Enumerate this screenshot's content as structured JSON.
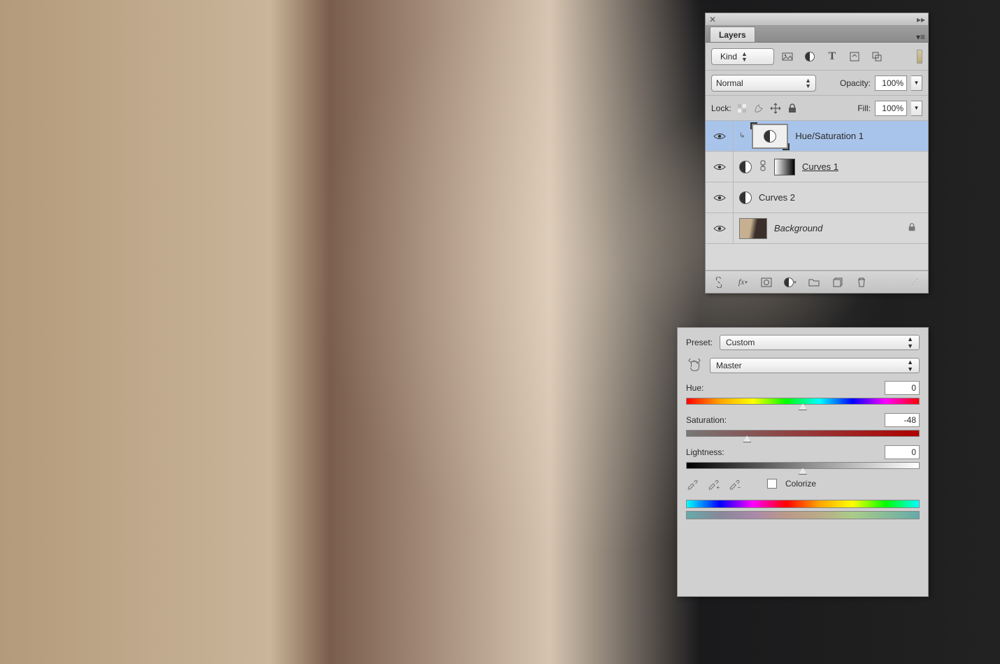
{
  "layers_panel": {
    "tab_label": "Layers",
    "filter": {
      "label": "Kind"
    },
    "blend_mode": "Normal",
    "opacity": {
      "label": "Opacity:",
      "value": "100%"
    },
    "lock_label": "Lock:",
    "fill": {
      "label": "Fill:",
      "value": "100%"
    },
    "layers": [
      {
        "name": "Hue/Saturation 1",
        "selected": true,
        "clipped": true
      },
      {
        "name": "Curves 1",
        "selected": false,
        "linked": true,
        "mask": true,
        "underline": true
      },
      {
        "name": "Curves 2",
        "selected": false
      },
      {
        "name": "Background",
        "selected": false,
        "italic": true,
        "locked": true,
        "is_image": true
      }
    ]
  },
  "hs_panel": {
    "preset_label": "Preset:",
    "preset_value": "Custom",
    "channel_value": "Master",
    "hue": {
      "label": "Hue:",
      "value": "0",
      "pos": 50
    },
    "saturation": {
      "label": "Saturation:",
      "value": "-48",
      "pos": 26
    },
    "lightness": {
      "label": "Lightness:",
      "value": "0",
      "pos": 50
    },
    "colorize_label": "Colorize"
  }
}
